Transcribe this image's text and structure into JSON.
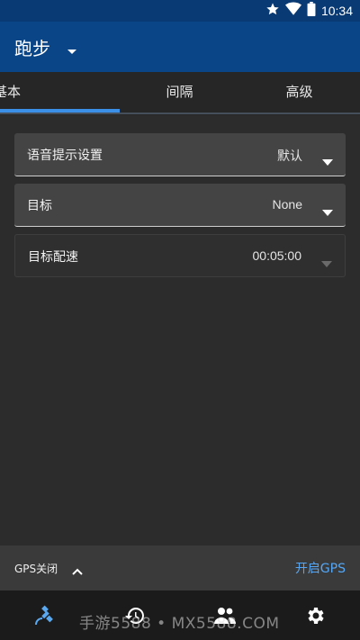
{
  "status_bar": {
    "time": "10:34",
    "icons": [
      "star-icon",
      "wifi-icon",
      "battery-icon"
    ]
  },
  "app_bar": {
    "title": "跑步"
  },
  "tabs": [
    {
      "label": "基本",
      "selected": true
    },
    {
      "label": "间隔",
      "selected": false
    },
    {
      "label": "高级",
      "selected": false
    }
  ],
  "settings": [
    {
      "label": "语音提示设置",
      "value": "默认",
      "enabled": true
    },
    {
      "label": "目标",
      "value": "None",
      "enabled": true
    },
    {
      "label": "目标配速",
      "value": "00:05:00",
      "enabled": false
    }
  ],
  "gps_bar": {
    "status": "GPS关闭",
    "action": "开启GPS"
  },
  "bottom_nav": [
    {
      "icon": "gps-satellite-icon",
      "active": true
    },
    {
      "icon": "history-icon",
      "active": false
    },
    {
      "icon": "group-icon",
      "active": false
    },
    {
      "icon": "settings-gear-icon",
      "active": false
    }
  ],
  "watermark": "手游5588 • MX5588.COM",
  "colors": {
    "app_bar": "#0a4588",
    "accent": "#3b8fe6",
    "gps_action": "#55a7f5"
  }
}
